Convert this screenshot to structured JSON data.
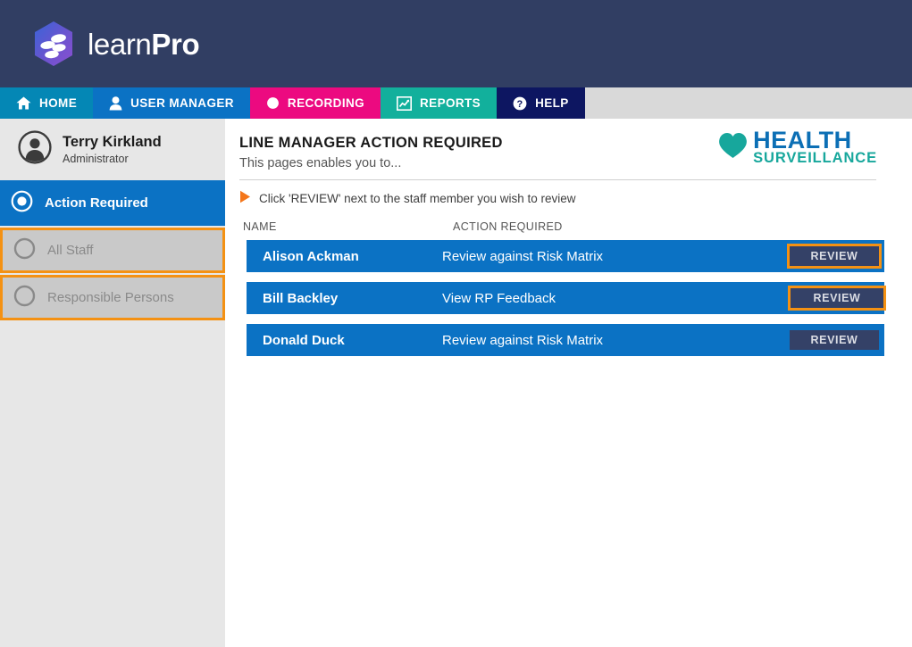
{
  "brand": {
    "name_light": "learn",
    "name_bold": "Pro",
    "logo_icon": "hexagon-logo-icon",
    "bar_color": "#313e63"
  },
  "nav": {
    "items": [
      {
        "label": "HOME",
        "icon": "home-icon",
        "bg": "#0487b5"
      },
      {
        "label": "USER MANAGER",
        "icon": "user-icon",
        "bg": "#0b72c4"
      },
      {
        "label": "RECORDING",
        "icon": "record-dot-icon",
        "bg": "#ec0a80"
      },
      {
        "label": "REPORTS",
        "icon": "chart-icon",
        "bg": "#12b09c"
      },
      {
        "label": "HELP",
        "icon": "question-circle-icon",
        "bg": "#0d1661"
      }
    ],
    "trailing_bg": "#d9d9d9"
  },
  "sidebar": {
    "user": {
      "avatar_icon": "avatar-icon",
      "name": "Terry Kirkland",
      "role": "Administrator"
    },
    "items": [
      {
        "label": "Action Required",
        "state": "active",
        "icon": "radio-selected-icon"
      },
      {
        "label": "All Staff",
        "state": "inactive",
        "icon": "radio-empty-icon"
      },
      {
        "label": "Responsible Persons",
        "state": "inactive",
        "icon": "radio-empty-icon"
      }
    ],
    "focus_color": "#f49113",
    "active_color": "#0b72c4"
  },
  "main": {
    "title": "LINE MANAGER ACTION REQUIRED",
    "subtitle": "This pages enables you to...",
    "hint": "Click 'REVIEW' next to the staff member you wish to review",
    "hint_icon": "triangle-right-icon",
    "hs_logo": {
      "heart_icon": "heart-icon",
      "line1": "HEALTH",
      "line2": "SURVEILLANCE",
      "heart_color": "#17a79c",
      "line1_color": "#0c6fb5",
      "line2_color": "#17a79c"
    },
    "table": {
      "columns": [
        "NAME",
        "ACTION REQUIRED"
      ],
      "row_color": "#0b72c4",
      "button_color": "#344167",
      "rows": [
        {
          "name": "Alison Ackman",
          "action": "Review against Risk Matrix",
          "button": "REVIEW",
          "focused": true
        },
        {
          "name": "Bill Backley",
          "action": "View RP Feedback",
          "button": "REVIEW",
          "focused": true
        },
        {
          "name": "Donald Duck",
          "action": "Review against Risk Matrix",
          "button": "REVIEW",
          "focused": false
        }
      ]
    }
  }
}
